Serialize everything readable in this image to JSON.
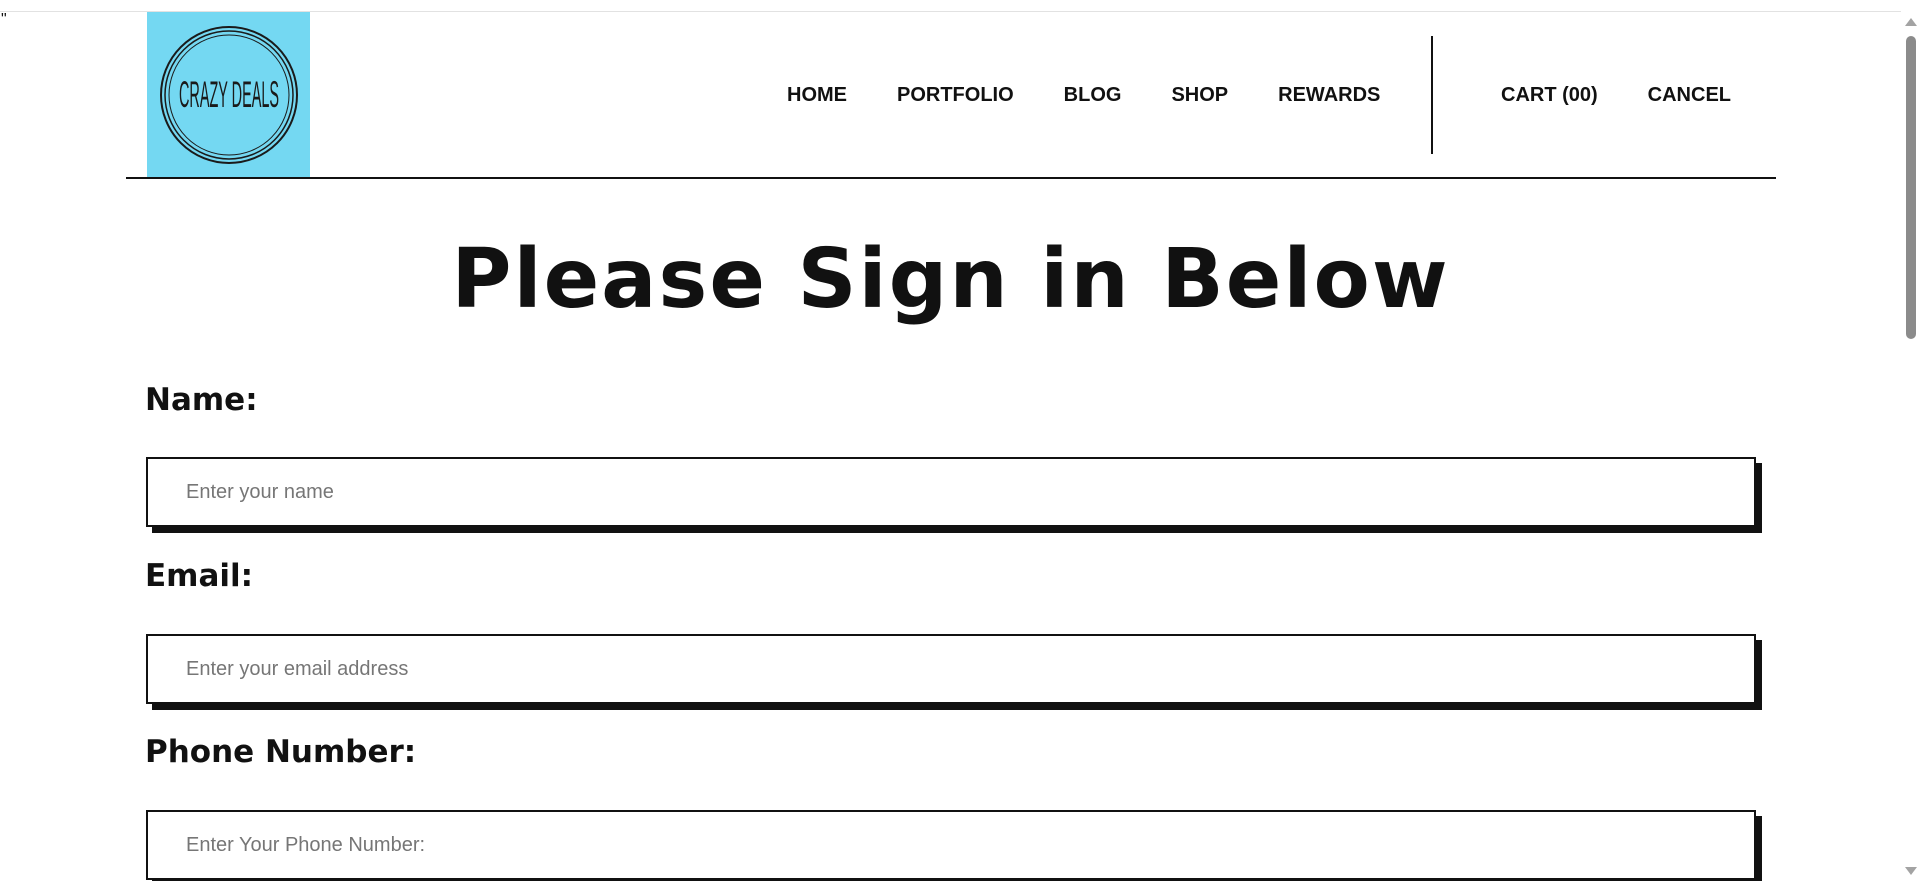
{
  "stray_mark": "\"",
  "logo": {
    "text": "CRAZY DEALS",
    "background_color": "#74d8f2"
  },
  "nav": {
    "items": [
      {
        "label": "HOME"
      },
      {
        "label": "PORTFOLIO"
      },
      {
        "label": "BLOG"
      },
      {
        "label": "SHOP"
      },
      {
        "label": "REWARDS"
      }
    ],
    "cart_label": "CART (00)",
    "cancel_label": "CANCEL"
  },
  "page_title": "Please Sign in Below",
  "form": {
    "name_label": "Name:",
    "name_placeholder": "Enter your name",
    "email_label": "Email:",
    "email_placeholder": "Enter your email address",
    "phone_label": "Phone Number:",
    "phone_placeholder": "Enter Your Phone Number:"
  },
  "colors": {
    "text": "#111111",
    "logo_bg": "#74d8f2"
  }
}
